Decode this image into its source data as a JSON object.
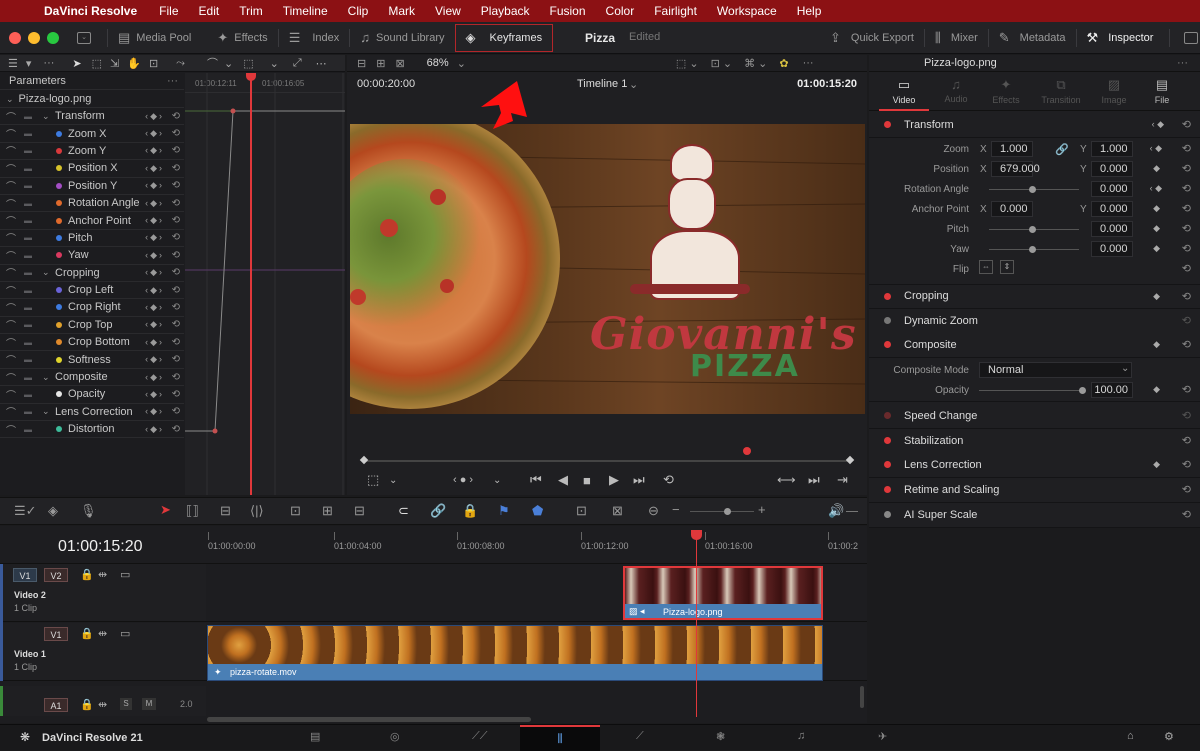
{
  "menubar": {
    "app_name": "DaVinci Resolve",
    "items": [
      "File",
      "Edit",
      "Trim",
      "Timeline",
      "Clip",
      "Mark",
      "View",
      "Playback",
      "Fusion",
      "Color",
      "Fairlight",
      "Workspace",
      "Help"
    ]
  },
  "toolbar": {
    "media_pool": "Media Pool",
    "effects": "Effects",
    "index": "Index",
    "sound_library": "Sound Library",
    "keyframes": "Keyframes",
    "project_name": "Pizza",
    "project_status": "Edited",
    "quick_export": "Quick Export",
    "mixer": "Mixer",
    "metadata": "Metadata",
    "inspector": "Inspector"
  },
  "keyframes_panel": {
    "title": "Parameters",
    "clip": "Pizza-logo.png",
    "timecodes": [
      "01:00:12:11",
      "01:00:16:05"
    ],
    "params": [
      {
        "label": "Transform",
        "type": "group"
      },
      {
        "label": "Zoom X",
        "color": "#3d7be0"
      },
      {
        "label": "Zoom Y",
        "color": "#d9393c"
      },
      {
        "label": "Position X",
        "color": "#d6c22a"
      },
      {
        "label": "Position Y",
        "color": "#a34ec4"
      },
      {
        "label": "Rotation Angle",
        "color": "#e06a2c"
      },
      {
        "label": "Anchor Point",
        "color": "#e06a2c"
      },
      {
        "label": "Pitch",
        "color": "#3d7be0"
      },
      {
        "label": "Yaw",
        "color": "#d9395f"
      },
      {
        "label": "Cropping",
        "type": "group"
      },
      {
        "label": "Crop Left",
        "color": "#6a63d8"
      },
      {
        "label": "Crop Right",
        "color": "#3d7be0"
      },
      {
        "label": "Crop Top",
        "color": "#e0a12c"
      },
      {
        "label": "Crop Bottom",
        "color": "#e08a2c"
      },
      {
        "label": "Softness",
        "color": "#e0d52c"
      },
      {
        "label": "Composite",
        "type": "group"
      },
      {
        "label": "Opacity",
        "color": "#e6e6e6"
      },
      {
        "label": "Lens Correction",
        "type": "group"
      },
      {
        "label": "Distortion",
        "color": "#3dbb9a"
      }
    ]
  },
  "viewer": {
    "zoom": "68%",
    "source_timecode": "00:00:20:00",
    "timeline_name": "Timeline 1",
    "record_timecode": "01:00:15:20",
    "logo_line1": "Giovanni's",
    "logo_line2": "PIZZA"
  },
  "inspector": {
    "clip_name": "Pizza-logo.png",
    "tabs": [
      "Video",
      "Audio",
      "Effects",
      "Transition",
      "Image",
      "File"
    ],
    "active_tab": "Video",
    "transform_title": "Transform",
    "zoom_label": "Zoom",
    "zoom_x": "1.000",
    "zoom_y": "1.000",
    "position_label": "Position",
    "position_x": "679.000",
    "position_y": "0.000",
    "rotation_label": "Rotation Angle",
    "rotation_value": "0.000",
    "anchor_label": "Anchor Point",
    "anchor_x": "0.000",
    "anchor_y": "0.000",
    "pitch_label": "Pitch",
    "pitch_value": "0.000",
    "yaw_label": "Yaw",
    "yaw_value": "0.000",
    "flip_label": "Flip",
    "x_label": "X",
    "y_label": "Y",
    "sections": [
      "Cropping",
      "Dynamic Zoom",
      "Composite"
    ],
    "composite_mode_label": "Composite Mode",
    "composite_mode_value": "Normal",
    "opacity_label": "Opacity",
    "opacity_value": "100.00",
    "lower_sections": [
      "Speed Change",
      "Stabilization",
      "Lens Correction",
      "Retime and Scaling",
      "AI Super Scale"
    ]
  },
  "timeline": {
    "timecode": "01:00:15:20",
    "ruler": [
      "01:00:00:00",
      "01:00:04:00",
      "01:00:08:00",
      "01:00:12:00",
      "01:00:16:00",
      "01:00:2"
    ],
    "tracks": [
      {
        "id": "V2",
        "name": "Video 2",
        "clips": "1 Clip"
      },
      {
        "id": "V1",
        "name": "Video 1",
        "clips": "1 Clip"
      },
      {
        "id": "A1",
        "volume": "2.0",
        "s": "S",
        "m": "M"
      }
    ],
    "v2_clip": "Pizza-logo.png",
    "v1_clip": "pizza-rotate.mov",
    "tag_v1": "V1",
    "tag_v2": "V2"
  },
  "footer": {
    "app_name": "DaVinci Resolve 21"
  },
  "colors": {
    "accent_red": "#e0383b",
    "clip_blue": "#4a7fb5",
    "menubar": "#8c1114"
  }
}
